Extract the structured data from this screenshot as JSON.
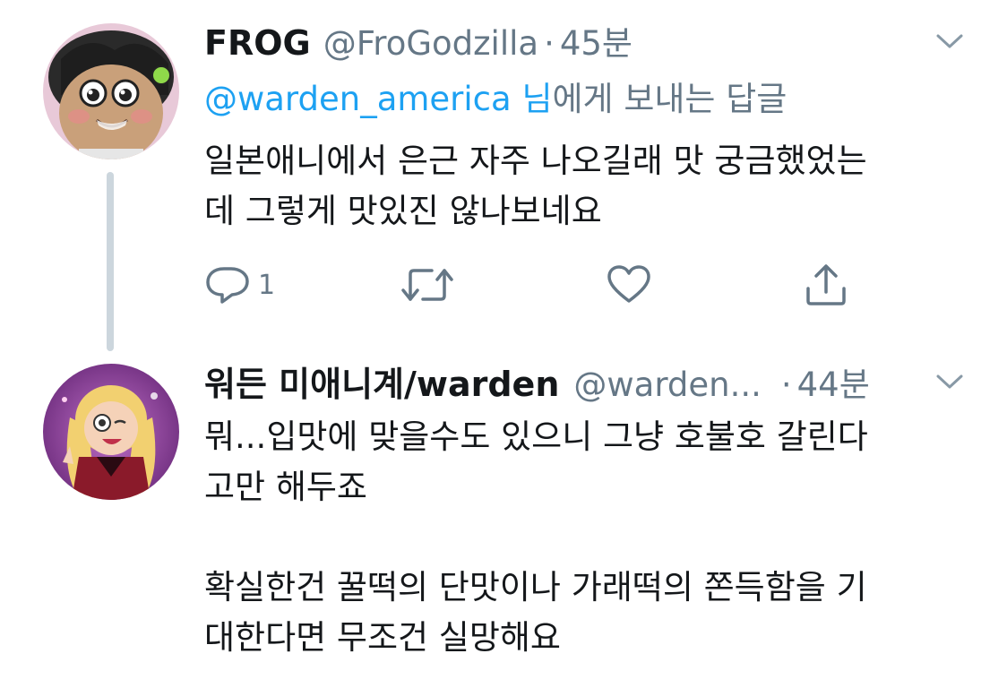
{
  "tweet1": {
    "name": "FROG",
    "handle": "@FroGodzilla",
    "separator": "·",
    "time": "45분",
    "reply_to_mention": "@warden_america 님",
    "reply_to_suffix": "에게 보내는 답글",
    "text_lines": [
      "일본애니에서 은근 자주 나오길래 맛 궁금했었는",
      "데 그렇게 맛있진 않나보네요"
    ],
    "reply_count": "1",
    "avatar_icon": "cartoon-frog-avatar"
  },
  "tweet2": {
    "name": "워든 미애니계/warden",
    "handle": "@warden...",
    "separator": "·",
    "time": "44분",
    "text_lines": [
      "뭐...입맛에 맞을수도 있으니 그냥 호불호 갈린다",
      "고만 해두죠"
    ],
    "text_lines_2": [
      "확실한건 꿀떡의 단맛이나 가래떡의 쫀득함을 기",
      "대한다면 무조건 실망해요"
    ],
    "avatar_icon": "cartoon-girl-avatar"
  },
  "icons": {
    "reply": "reply-bubble-icon",
    "retweet": "retweet-icon",
    "like": "heart-icon",
    "share": "share-upload-icon",
    "menu": "chevron-down-icon"
  },
  "colors": {
    "mention": "#1da1f2",
    "meta": "#657786",
    "text": "#14171a",
    "thread_line": "#ccd6dd"
  }
}
